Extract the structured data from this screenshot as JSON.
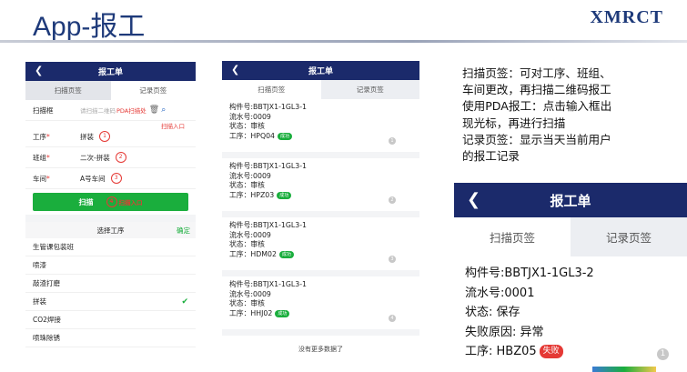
{
  "slide": {
    "title": "App-报工",
    "logo": "XMRCT"
  },
  "phone1": {
    "nav_title": "报工单",
    "tabs": [
      "扫描页签",
      "记录页签"
    ],
    "scan_label": "扫描框",
    "scan_placeholder": "请扫描二维码",
    "scan_hint": "PDA扫描处",
    "scan_entry": "扫描入口",
    "fields": [
      {
        "label": "工序",
        "value": "拼装",
        "num": "1"
      },
      {
        "label": "班组",
        "value": "二次-拼装",
        "num": "2"
      },
      {
        "label": "车间",
        "value": "A号车间",
        "num": "3"
      }
    ],
    "scan_button": "扫描",
    "scan_button_num": "4",
    "scan_button_hint": "扫描入口",
    "picker_title": "选择工序",
    "picker_ok": "确定",
    "processes": [
      "生管课包装班",
      "喷漆",
      "敲渣打磨",
      "拼装",
      "CO2焊接",
      "喷珠除锈"
    ]
  },
  "phone2": {
    "nav_title": "报工单",
    "tabs": [
      "扫描页签",
      "记录页签"
    ],
    "records": [
      {
        "part": "构件号:BBTJX1-1GL3-1",
        "serial": "流水号:0009",
        "state": "状态：审核",
        "process": "工序：HPQ04",
        "badge": "成功",
        "num": "1"
      },
      {
        "part": "构件号:BBTJX1-1GL3-1",
        "serial": "流水号:0009",
        "state": "状态：审核",
        "process": "工序：HPZ03",
        "badge": "成功",
        "num": "2"
      },
      {
        "part": "构件号:BBTJX1-1GL3-1",
        "serial": "流水号:0009",
        "state": "状态：审核",
        "process": "工序：HDM02",
        "badge": "成功",
        "num": "3"
      },
      {
        "part": "构件号:BBTJX1-1GL3-1",
        "serial": "流水号:0009",
        "state": "状态：审核",
        "process": "工序：HHJ02",
        "badge": "成功",
        "num": "4"
      }
    ],
    "no_more": "没有更多数据了"
  },
  "description": [
    "扫描页签：可对工序、班组、",
    "车间更改，再扫描二维码报工",
    "使用PDA报工：点击输入框出",
    "现光标，再进行扫描",
    "记录页签：显示当天当前用户",
    "的报工记录"
  ],
  "phone3": {
    "nav_title": "报工单",
    "tabs": [
      "扫描页签",
      "记录页签"
    ],
    "record": {
      "part": "构件号:BBTJX1-1GL3-2",
      "serial": "流水号:0001",
      "state": "状态: 保存",
      "reason": "失败原因: 异常",
      "process": "工序: HBZ05",
      "badge": "失败",
      "num": "1"
    }
  },
  "colors": {
    "nav": "#1b2a6b",
    "success": "#1aae3d",
    "fail": "#e53935",
    "title": "#1e3a7a"
  }
}
